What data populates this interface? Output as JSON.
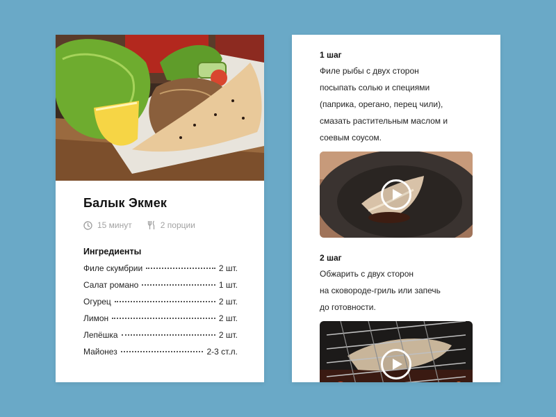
{
  "recipe": {
    "title": "Балык Экмек",
    "time": "15 минут",
    "servings": "2 порции",
    "ingredients_title": "Ингредиенты",
    "ingredients": [
      {
        "name": "Филе скумбрии",
        "qty": "2 шт."
      },
      {
        "name": "Салат романо",
        "qty": "1 шт."
      },
      {
        "name": "Огурец",
        "qty": "2 шт."
      },
      {
        "name": "Лимон",
        "qty": "2 шт."
      },
      {
        "name": "Лепёшка",
        "qty": "2 шт."
      },
      {
        "name": "Майонез",
        "qty": "2-3 ст.л."
      }
    ]
  },
  "steps": [
    {
      "label": "1 шаг",
      "lines": [
        "Филе рыбы с двух сторон",
        "посыпать солью и специями",
        "(паприка, орегано, перец чили),",
        "смазать растительным маслом и",
        "соевым соусом."
      ]
    },
    {
      "label": "2 шаг",
      "lines": [
        "Обжарить с двух сторон",
        "на сковороде-гриль или запечь",
        "до готовности."
      ]
    }
  ],
  "icons": {
    "time": "clock-icon",
    "servings": "fork-knife-icon",
    "play": "play-icon"
  },
  "colors": {
    "background": "#6aa9c7",
    "card": "#ffffff",
    "meta_text": "#a2a2a2"
  }
}
